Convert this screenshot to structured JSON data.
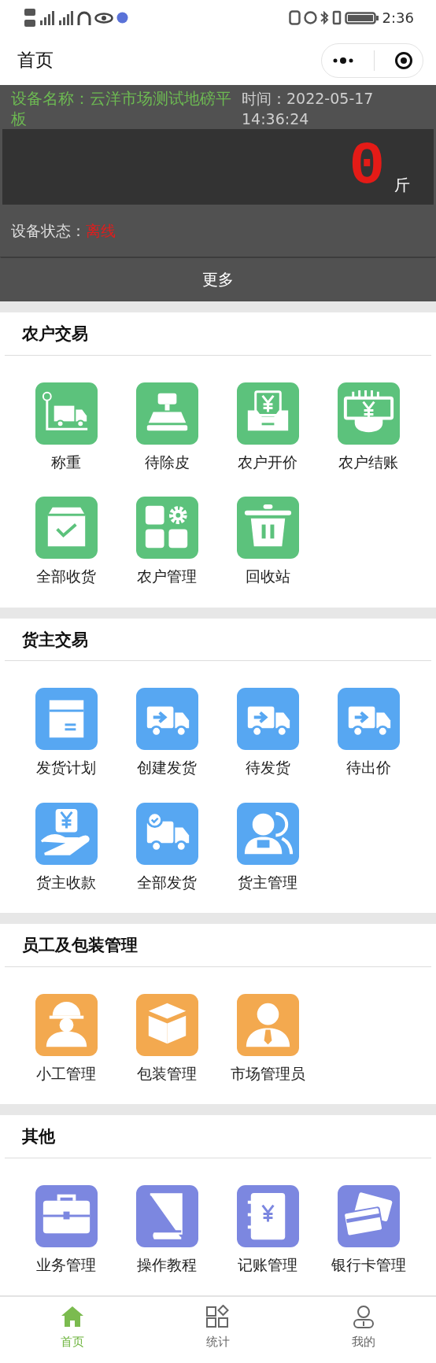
{
  "status_bar": {
    "time": "2:36"
  },
  "nav": {
    "title": "首页"
  },
  "device": {
    "name_label": "设备名称：",
    "name": "云洋市场测试地磅平板",
    "time_label": "时间：",
    "time": "2022-05-17 14:36:24",
    "weight": "0",
    "unit": "斤",
    "status_label": "设备状态：",
    "status": "离线",
    "more": "更多"
  },
  "sections": [
    {
      "title": "农户交易",
      "color": "#5cc27c",
      "items": [
        {
          "label": "称重"
        },
        {
          "label": "待除皮"
        },
        {
          "label": "农户开价"
        },
        {
          "label": "农户结账"
        },
        {
          "label": "全部收货"
        },
        {
          "label": "农户管理"
        },
        {
          "label": "回收站"
        }
      ]
    },
    {
      "title": "货主交易",
      "color": "#57a7f2",
      "items": [
        {
          "label": "发货计划"
        },
        {
          "label": "创建发货"
        },
        {
          "label": "待发货"
        },
        {
          "label": "待出价"
        },
        {
          "label": "货主收款"
        },
        {
          "label": "全部发货"
        },
        {
          "label": "货主管理"
        }
      ]
    },
    {
      "title": "员工及包装管理",
      "color": "#f3a94f",
      "items": [
        {
          "label": "小工管理"
        },
        {
          "label": "包装管理"
        },
        {
          "label": "市场管理员"
        }
      ]
    },
    {
      "title": "其他",
      "color": "#7c87e0",
      "items": [
        {
          "label": "业务管理"
        },
        {
          "label": "操作教程"
        },
        {
          "label": "记账管理"
        },
        {
          "label": "银行卡管理"
        }
      ]
    }
  ],
  "tabs": [
    {
      "label": "首页",
      "selected": true
    },
    {
      "label": "统计",
      "selected": false
    },
    {
      "label": "我的",
      "selected": false
    }
  ]
}
